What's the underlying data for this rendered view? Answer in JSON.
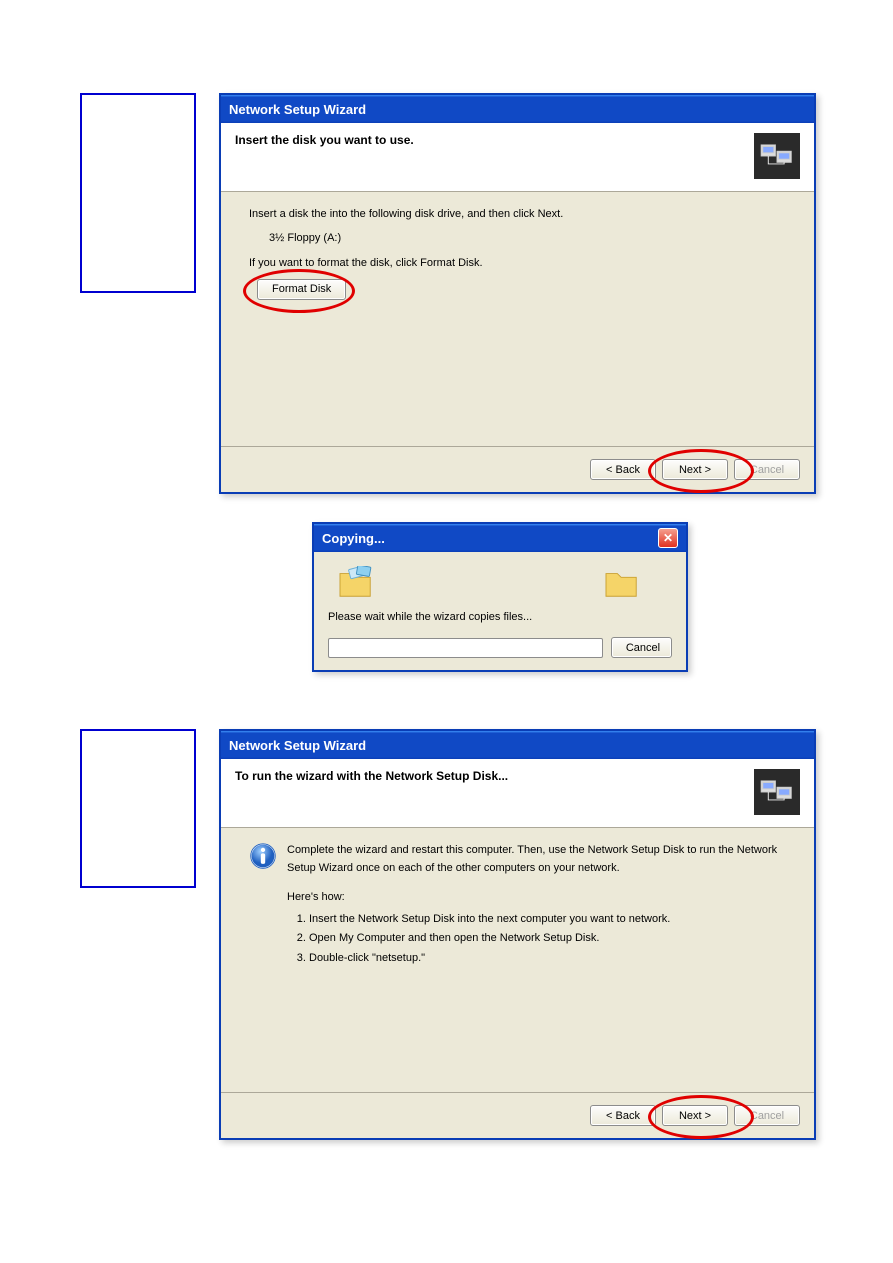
{
  "dialog1": {
    "title": "Network Setup Wizard",
    "header": "Insert the disk you want to use.",
    "instr1": "Insert a disk the into the following disk drive, and then click Next.",
    "drive": "3½ Floppy (A:)",
    "instr2": "If you want to format the disk, click Format Disk.",
    "format_btn": "Format Disk",
    "back_btn": "< Back",
    "next_btn": "Next >",
    "cancel_btn": "Cancel"
  },
  "copying": {
    "title": "Copying...",
    "wait": "Please wait while the wizard copies files...",
    "cancel": "Cancel"
  },
  "dialog2": {
    "title": "Network Setup Wizard",
    "header": "To run the wizard with the Network Setup Disk...",
    "intro": "Complete the wizard and restart this computer. Then, use the Network Setup Disk to run the Network Setup Wizard once on each of the other computers on your network.",
    "how": "Here's how:",
    "step1": "Insert the Network Setup Disk into the next computer you want to network.",
    "step2": "Open My Computer and then open the Network Setup Disk.",
    "step3": "Double-click \"netsetup.\"",
    "back_btn": "< Back",
    "next_btn": "Next >",
    "cancel_btn": "Cancel"
  }
}
